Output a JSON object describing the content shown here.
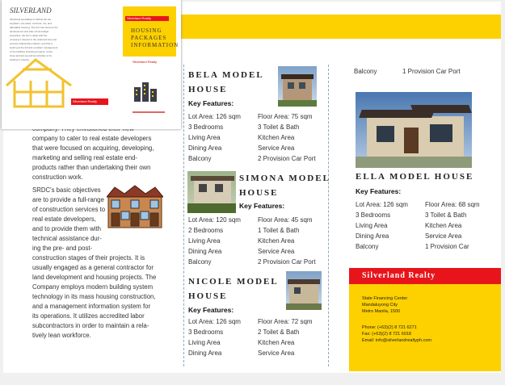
{
  "thumb": {
    "left_title": "SILVERLAND",
    "left_text": "Silverland specialises in Abbott ble sia suppliers, lots sales; concrete; ros; and affordable housing. The firm has become the development and sale of low-budget properties; the firm's deals with the company's interest in the retail and low-cost process relationship industry, and that is looking at the full and excellent management of the facilities including property, rental, close and tips as well as activities of its holding in industry.",
    "left_badge": "Silverland Realty",
    "right_badge": "Silverland Realty",
    "right_title": [
      "Housing",
      "Packages",
      "Information"
    ],
    "right_sub": "Silverland Realty"
  },
  "left": {
    "para1": "company. They envisioned their new company to cater to real estate developers that were focused on acquiring, developing, marketing and selling real estate end-products rather than undertaking their own construction work.",
    "para2_lines": [
      "SRDC's basic objectives",
      "are to provide a full-range",
      "of construction services to",
      "real estate developers,",
      "and to provide them with",
      "technical assistance dur-",
      "ing the pre- and post-",
      "construction stages of their projects. It is",
      "usually engaged as a general contractor for",
      "land development and housing projects. The",
      "Company employs modern building system",
      "technology in its mass housing construction,",
      "and a management information system for",
      "its operations. It utilizes accredited labor",
      "subcontractors in order to maintain a rela-",
      "tively lean workforce."
    ]
  },
  "middle": {
    "bela": {
      "title1": "Bela model",
      "title2": "house",
      "key": "Key Features:",
      "rows": [
        [
          "Lot Area: 126 sqm",
          "Floor Area: 75 sqm"
        ],
        [
          "3 Bedrooms",
          "3 Toilet & Bath"
        ],
        [
          "Living Area",
          "Kitchen Area"
        ],
        [
          "Dining Area",
          "Service Area"
        ],
        [
          "Balcony",
          "2 Provision Car Port"
        ]
      ]
    },
    "simona": {
      "title1": "Simona model",
      "title2": "house",
      "key": "Key Features:",
      "rows": [
        [
          "Lot Area: 120 sqm",
          "Floor Area: 45 sqm"
        ],
        [
          "2 Bedrooms",
          "1 Toilet & Bath"
        ],
        [
          "Living Area",
          "Kitchen Area"
        ],
        [
          "Dining Area",
          "Service Area"
        ],
        [
          "Balcony",
          "2 Provision Car Port"
        ]
      ]
    },
    "nicole": {
      "title1": "Nicole model",
      "title2": "house",
      "key": "Key Features:",
      "rows": [
        [
          "Lot Area: 126 sqm",
          "Floor Area: 72 sqm"
        ],
        [
          "3 Bedrooms",
          "2 Toilet & Bath"
        ],
        [
          "Living Area",
          "Kitchen Area"
        ],
        [
          "Dining Area",
          "Service Area"
        ]
      ]
    }
  },
  "right": {
    "top_row": [
      "Balcony",
      "1 Provision Car Port"
    ],
    "ella": {
      "title": "Ella model house",
      "key": "Key Features:",
      "rows": [
        [
          "Lot Area: 126 sqm",
          "Floor Area: 68 sqm"
        ],
        [
          "3 Bedrooms",
          "3 Toilet & Bath"
        ],
        [
          "Living Area",
          "Kitchen Area"
        ],
        [
          "Dining Area",
          "Service Area"
        ],
        [
          "Balcony",
          "1 Provision Car"
        ]
      ]
    },
    "footer": {
      "brand": "Silverland Realty",
      "address": [
        "State Financing Center",
        "Mandaluyong City",
        "Metro Manila, 1500"
      ],
      "phone": "Phone: (+63)(2) 8 721 6271",
      "fax": "Fax: (+63)(2) 8 721 6018",
      "email": "Email: info@silverlandrealtyph.com"
    }
  },
  "colors": {
    "yellow": "#fdd000",
    "red": "#e8141c",
    "gold_icon": "#f2c230"
  }
}
